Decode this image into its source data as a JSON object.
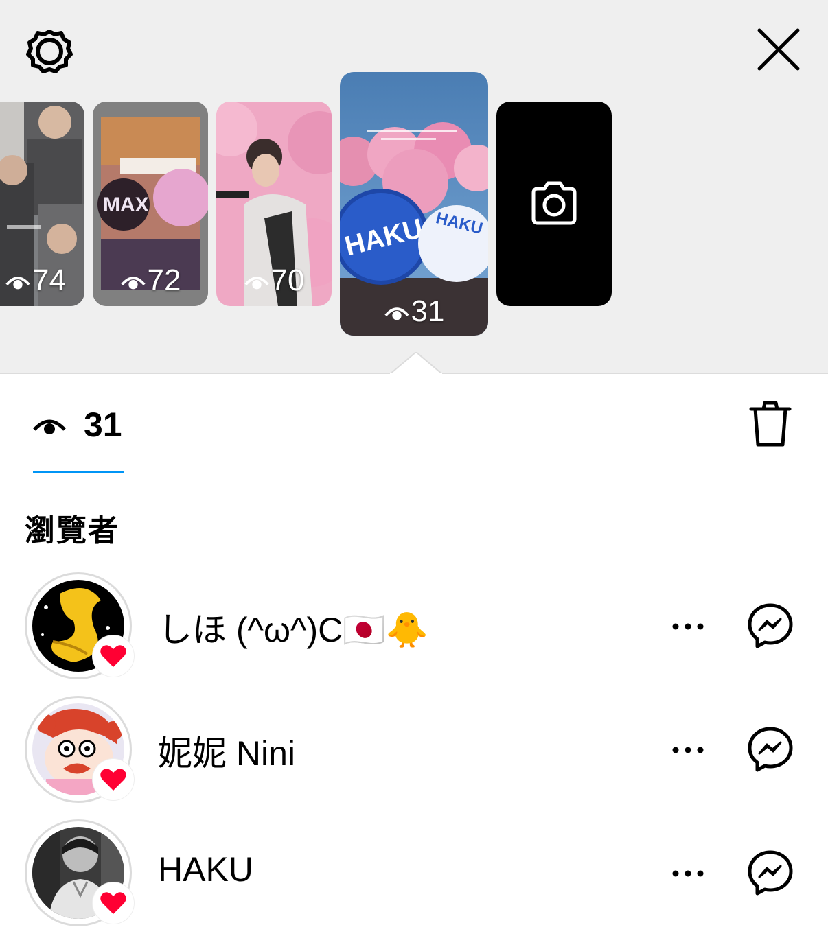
{
  "header": {
    "settings_icon": "gear-icon",
    "close_icon": "close-icon"
  },
  "stories": [
    {
      "views": "74",
      "active": false
    },
    {
      "views": "72",
      "active": false
    },
    {
      "views": "70",
      "active": false
    },
    {
      "views": "31",
      "active": true
    }
  ],
  "camera_tile": {
    "icon": "camera-icon"
  },
  "stats": {
    "view_count": "31",
    "eye_icon": "eye-icon",
    "delete_icon": "trash-icon",
    "accent_color": "#0095f6"
  },
  "viewers_section": {
    "title": "瀏覽者",
    "viewers": [
      {
        "name": "しほ (^ω^)C🇯🇵🐥",
        "liked": true,
        "more_label": "···",
        "message_icon": "messenger-icon"
      },
      {
        "name": "妮妮 Nini",
        "liked": true,
        "more_label": "···",
        "message_icon": "messenger-icon"
      },
      {
        "name": "HAKU",
        "liked": true,
        "more_label": "···",
        "message_icon": "messenger-icon"
      }
    ],
    "heart_color": "#ff0033"
  }
}
